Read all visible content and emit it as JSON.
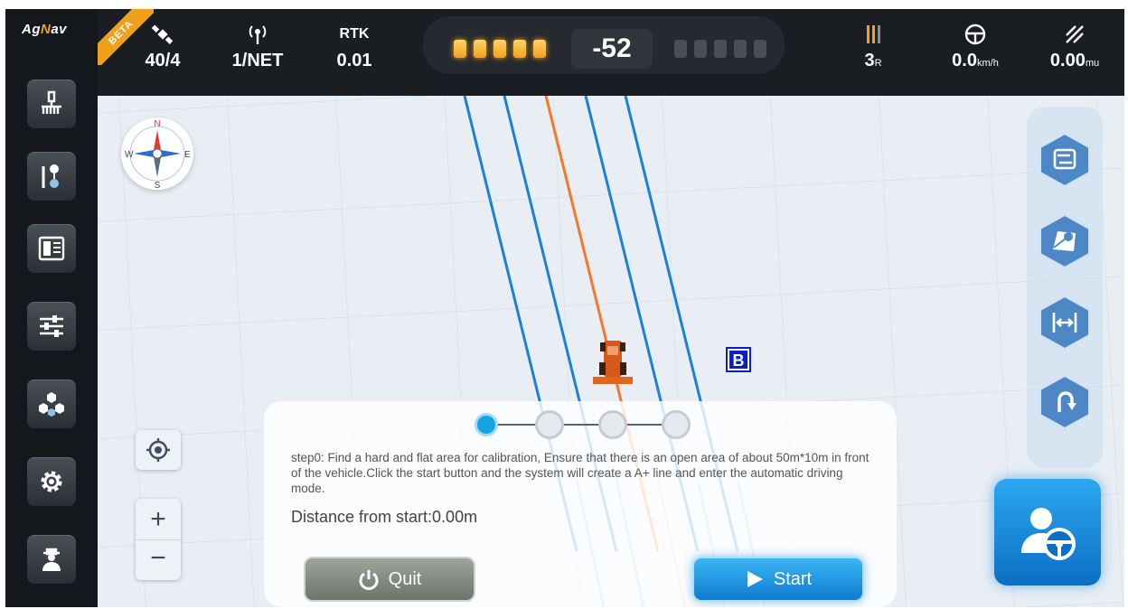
{
  "app": {
    "brand_a": "Ag",
    "brand_b": "N",
    "brand_c": "av",
    "beta": "BETA"
  },
  "topbar": {
    "satellites": "40/4",
    "network": "1/NET",
    "rtk_label": "RTK",
    "rtk_value": "0.01",
    "cross_track_error": "-52",
    "lightbar_left_on": 5,
    "lightbar_right_on": 0,
    "row": "3",
    "row_unit": "R",
    "speed": "0.0",
    "speed_unit": "km/h",
    "area": "0.00",
    "area_unit": "mu"
  },
  "map": {
    "b_marker": "B",
    "compass": {
      "n": "N",
      "s": "S",
      "e": "E",
      "w": "W"
    }
  },
  "calibration": {
    "steps_total": 4,
    "active_step": 0,
    "description": "step0: Find a hard and flat area for calibration, Ensure that there is an open area of about 50m*10m in front of the vehicle.Click the start button and the system will create a A+ line and enter the automatic driving mode.",
    "distance": "Distance from start:0.00m",
    "quit_label": "Quit",
    "start_label": "Start"
  },
  "zoom": {
    "plus": "+",
    "minus": "−"
  },
  "colors": {
    "accent": "#17a4e6",
    "guide_line": "#1e7fd6",
    "active_line": "#f07a2a",
    "lightbar": "#f4a01c"
  },
  "sidebar": {
    "items": [
      "implement-icon",
      "ab-line-icon",
      "field-info-icon",
      "settings-sliders-icon",
      "network-icon",
      "gear-icon",
      "operator-icon"
    ]
  }
}
